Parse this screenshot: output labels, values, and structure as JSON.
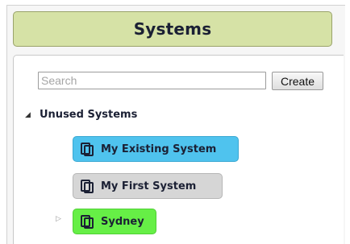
{
  "header": {
    "title": "Systems"
  },
  "search": {
    "placeholder": "Search",
    "value": ""
  },
  "toolbar": {
    "create_label": "Create"
  },
  "tree": {
    "group": {
      "label": "Unused Systems",
      "toggle": "◢",
      "expanded": true
    },
    "nodes": [
      {
        "label": "My Existing System",
        "icon": "copy-icon",
        "color": "#4fc3ee",
        "border": "#3aa8d2"
      },
      {
        "label": "My First System",
        "icon": "copy-icon",
        "color": "#d6d6d6",
        "border": "#b6b6b6"
      },
      {
        "label": "Sydney",
        "icon": "copy-icon",
        "color": "#66ef46",
        "border": "#4fcf34",
        "toggle": "▷",
        "expandable": true
      }
    ]
  }
}
